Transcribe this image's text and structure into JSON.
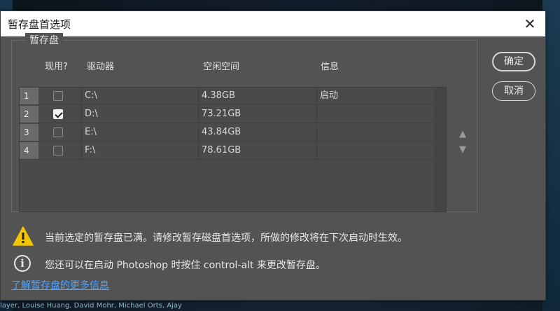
{
  "background": {
    "credits": "layer, Louise Huang, David Mohr, Michael Orts, Ajay"
  },
  "window": {
    "title": "暂存盘首选项",
    "close_symbol": "✕"
  },
  "group": {
    "label": "暂存盘"
  },
  "columns": {
    "active": "现用?",
    "drive": "驱动器",
    "free": "空闲空间",
    "info": "信息"
  },
  "rows": [
    {
      "num": "1",
      "checked": false,
      "drive": "C:\\",
      "free": "4.38GB",
      "info": "启动"
    },
    {
      "num": "2",
      "checked": true,
      "drive": "D:\\",
      "free": "73.21GB",
      "info": ""
    },
    {
      "num": "3",
      "checked": false,
      "drive": "E:\\",
      "free": "43.84GB",
      "info": ""
    },
    {
      "num": "4",
      "checked": false,
      "drive": "F:\\",
      "free": "78.61GB",
      "info": ""
    }
  ],
  "move": {
    "up": "▲",
    "down": "▼"
  },
  "buttons": {
    "ok": "确定",
    "cancel": "取消"
  },
  "messages": {
    "warning": "当前选定的暂存盘已满。请修改暂存磁盘首选项，所做的修改将在下次启动时生效。",
    "info": "您还可以在启动 Photoshop 时按住 control-alt 来更改暂存盘。"
  },
  "link": {
    "text": "了解暂存盘的更多信息"
  },
  "colors": {
    "dialog_bg": "#535353",
    "warning_yellow": "#f5c400",
    "link_blue": "#4da3ff"
  }
}
